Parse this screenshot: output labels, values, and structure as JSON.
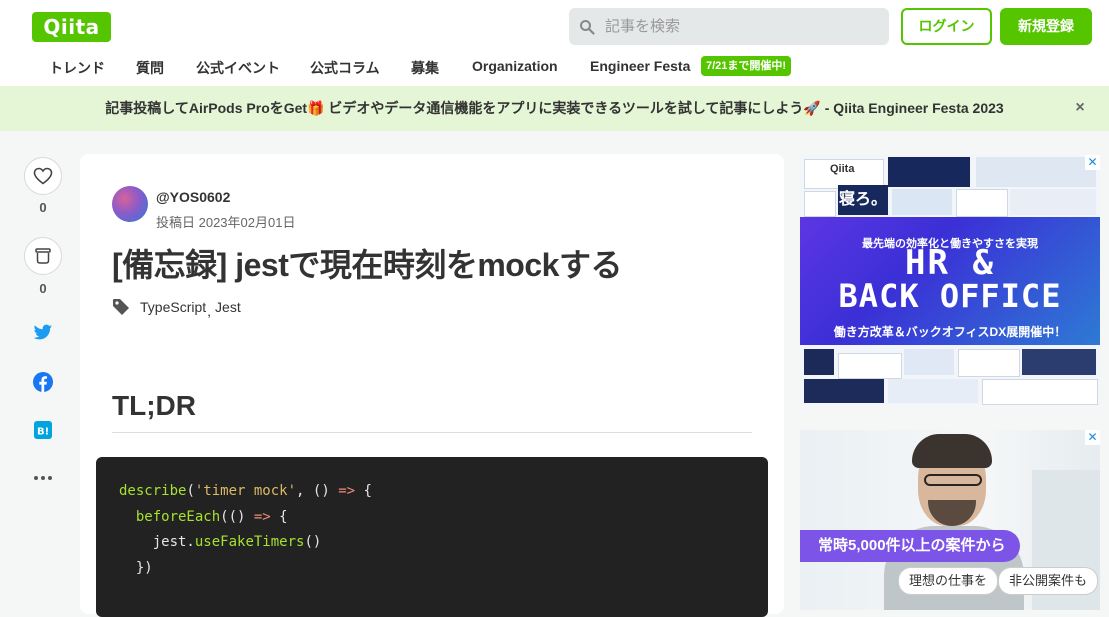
{
  "header": {
    "logo": "Qiita",
    "search_placeholder": "記事を検索",
    "login": "ログイン",
    "signup": "新規登録",
    "nav": [
      "トレンド",
      "質問",
      "公式イベント",
      "公式コラム",
      "募集",
      "Organization",
      "Engineer Festa"
    ],
    "nav_badge": "7/21まで開催中!"
  },
  "banner": {
    "text": "記事投稿してAirPods ProをGet🎁 ビデオやデータ通信機能をアプリに実装できるツールを試して記事にしよう🚀 - Qiita Engineer Festa 2023",
    "close": "×"
  },
  "sidebar": {
    "like_count": "0",
    "stock_count": "0"
  },
  "article": {
    "username": "@YOS0602",
    "post_date": "投稿日 2023年02月01日",
    "title": "[備忘録] jestで現在時刻をmockする",
    "tags": [
      "TypeScript",
      "Jest"
    ],
    "tag_sep": ",",
    "heading": "TL;DR",
    "code": {
      "line1": {
        "fn": "describe",
        "open": "(",
        "str": "'timer mock'",
        "rest": ", () ",
        "arrow": "=>",
        "end": " {"
      },
      "line2": {
        "indent": "  ",
        "fn": "beforeEach",
        "rest": "(() ",
        "arrow": "=>",
        "end": " {"
      },
      "line3": {
        "indent": "    ",
        "obj": "jest.",
        "fn": "useFakeTimers",
        "end": "()"
      },
      "line4": {
        "text": "  })"
      }
    }
  },
  "ads": {
    "ad1": {
      "brand": "Qiita",
      "subtitle": "最先端の効率化と働きやすさを実現",
      "headline1": "HR &",
      "headline2": "BACK OFFICE",
      "caption": "働き方改革＆バックオフィスDX展開催中！",
      "sleep": "寝ろ。"
    },
    "ad2": {
      "pill": "常時5,000件以上の案件から",
      "chip1": "理想の仕事を",
      "chip2": "非公開案件も"
    },
    "close_glyph": "✕"
  },
  "colors": {
    "brand": "#55c500",
    "banner_bg": "#e4f6d6",
    "code_bg": "#222222"
  }
}
